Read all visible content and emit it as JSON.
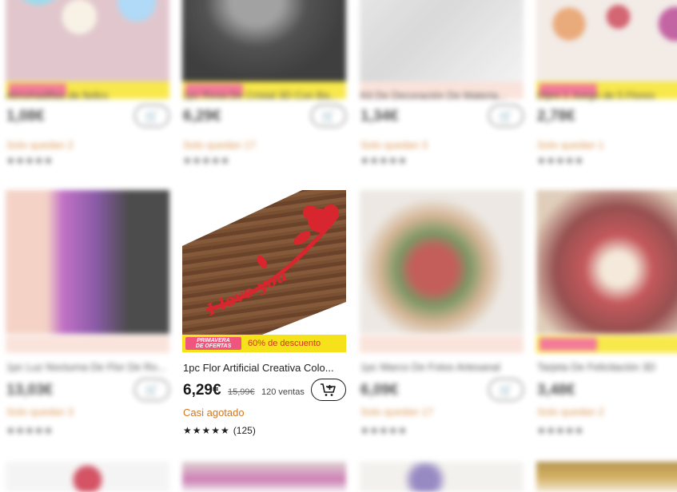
{
  "featured": {
    "title": "1pc Flor Artificial Creativa Colo...",
    "price": "6,29€",
    "old_price": "15,99€",
    "sold": "120 ventas",
    "discount_label": "60% de descuento",
    "promo_badge_line1": "PRIMAVERA",
    "promo_badge_line2": "DE OFERTAS",
    "status": "Casi agotado",
    "stars": "★★★★★",
    "review_count": "(125)",
    "image_text": "I love you"
  },
  "blurred_cards": {
    "row1": [
      {
        "title": "Almohadillas de fieltro",
        "price": "1,08€",
        "status": "Solo quedan 2"
      },
      {
        "title": "1pc Rosa De Cristal 3D Con Ba...",
        "price": "6,29€",
        "status": "Solo quedan 17"
      },
      {
        "title": "Kit De Decoración De Materia...",
        "price": "1,34€",
        "status": "Solo quedan 3"
      },
      {
        "title": "Dijes 1 Juego de 5 Flores",
        "price": "2,78€",
        "status": "Solo quedan 1"
      }
    ],
    "row2": [
      {
        "title": "1pc Luz Nocturna De Flor De Ro...",
        "price": "13,03€",
        "status": "Solo quedan 3"
      },
      {
        "title": "1pc Marco De Fotos Artesanal",
        "price": "6,09€",
        "status": "Solo quedan 17"
      },
      {
        "title": "Tarjeta De Felicitación 3D",
        "price": "3,48€",
        "status": "Solo quedan 2"
      }
    ]
  },
  "colors": {
    "promo_yellow": "#f6e21a",
    "promo_pink": "#f0557e",
    "status_orange": "#d2771f",
    "discount_red": "#d6301f",
    "bar_peach": "#f8dcd2"
  },
  "icons": {
    "cart": "add-to-cart-icon"
  }
}
